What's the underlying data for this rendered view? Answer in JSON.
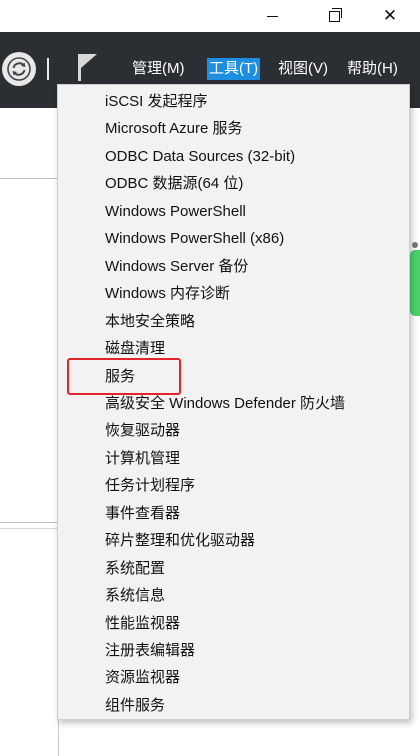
{
  "window": {
    "minimize_icon": "minimize-icon",
    "maximize_icon": "restore-icon",
    "close_icon": "close-icon",
    "close_glyph": "✕"
  },
  "toolbar": {
    "refresh_icon": "refresh-icon",
    "flag_icon": "flag-icon"
  },
  "menu": {
    "manage": "管理(M)",
    "tools": "工具(T)",
    "view": "视图(V)",
    "help": "帮助(H)"
  },
  "tools_menu": {
    "items": [
      "iSCSI 发起程序",
      "Microsoft Azure 服务",
      "ODBC Data Sources (32-bit)",
      "ODBC 数据源(64 位)",
      "Windows PowerShell",
      "Windows PowerShell (x86)",
      "Windows Server 备份",
      "Windows 内存诊断",
      "本地安全策略",
      "磁盘清理",
      "服务",
      "高级安全 Windows Defender 防火墙",
      "恢复驱动器",
      "计算机管理",
      "任务计划程序",
      "事件查看器",
      "碎片整理和优化驱动器",
      "系统配置",
      "系统信息",
      "性能监视器",
      "注册表编辑器",
      "资源监视器",
      "组件服务"
    ],
    "highlighted_index": 10,
    "highlight_color": "#e0262b"
  },
  "colors": {
    "header_bg": "#2b2e33",
    "menu_active_bg": "#1e8fe0",
    "scroll_thumb": "#4bd36a"
  }
}
